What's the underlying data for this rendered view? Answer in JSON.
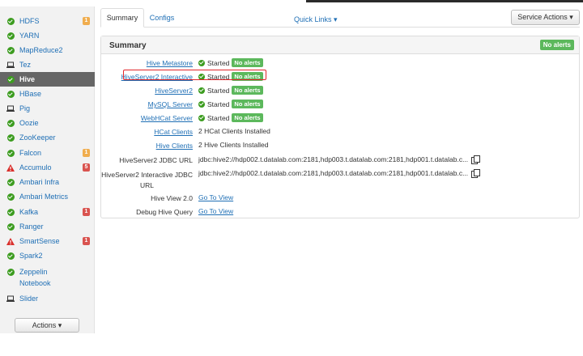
{
  "sidebar": {
    "services": [
      {
        "label": "HDFS",
        "status": "ok",
        "badge": "1",
        "badge_color": "orange"
      },
      {
        "label": "YARN",
        "status": "ok",
        "badge": ""
      },
      {
        "label": "MapReduce2",
        "status": "ok",
        "badge": ""
      },
      {
        "label": "Tez",
        "status": "client",
        "badge": ""
      },
      {
        "label": "Hive",
        "status": "ok",
        "badge": "",
        "active": true
      },
      {
        "label": "HBase",
        "status": "ok",
        "badge": ""
      },
      {
        "label": "Pig",
        "status": "client",
        "badge": ""
      },
      {
        "label": "Oozie",
        "status": "ok",
        "badge": ""
      },
      {
        "label": "ZooKeeper",
        "status": "ok",
        "badge": ""
      },
      {
        "label": "Falcon",
        "status": "ok",
        "badge": "1",
        "badge_color": "orange"
      },
      {
        "label": "Accumulo",
        "status": "warning",
        "badge": "5",
        "badge_color": "red"
      },
      {
        "label": "Ambari Infra",
        "status": "ok",
        "badge": ""
      },
      {
        "label": "Ambari Metrics",
        "status": "ok",
        "badge": ""
      },
      {
        "label": "Kafka",
        "status": "ok",
        "badge": "1",
        "badge_color": "red"
      },
      {
        "label": "Ranger",
        "status": "ok",
        "badge": ""
      },
      {
        "label": "SmartSense",
        "status": "warning",
        "badge": "1",
        "badge_color": "red"
      },
      {
        "label": "Spark2",
        "status": "ok",
        "badge": ""
      },
      {
        "label": "Zeppelin Notebook",
        "status": "ok",
        "badge": ""
      },
      {
        "label": "Slider",
        "status": "client",
        "badge": ""
      }
    ],
    "actions_label": "Actions ▾"
  },
  "tabs": {
    "summary": "Summary",
    "configs": "Configs",
    "quick_links": "Quick Links ▾",
    "service_actions": "Service Actions ▾"
  },
  "panel": {
    "title": "Summary",
    "header_badge": "No alerts",
    "rows": [
      {
        "key": "Hive Metastore",
        "key_link": true,
        "state": "Started",
        "alerts": "No alerts"
      },
      {
        "key": "HiveServer2 Interactive",
        "key_link": true,
        "state": "Started",
        "alerts": "No alerts"
      },
      {
        "key": "HiveServer2",
        "key_link": true,
        "state": "Started",
        "alerts": "No alerts"
      },
      {
        "key": "MySQL Server",
        "key_link": true,
        "state": "Started",
        "alerts": "No alerts"
      },
      {
        "key": "WebHCat Server",
        "key_link": true,
        "state": "Started",
        "alerts": "No alerts"
      },
      {
        "key": "HCat Clients",
        "key_link": true,
        "value": "2 HCat Clients Installed"
      },
      {
        "key": "Hive Clients",
        "key_link": true,
        "value": "2 Hive Clients Installed"
      },
      {
        "key": "HiveServer2 JDBC URL",
        "key_link": false,
        "value": "jdbc:hive2://hdp002.t.datalab.com:2181,hdp003.t.datalab.com:2181,hdp001.t.datalab.c..."
      },
      {
        "key_line1": "HiveServer2 Interactive JDBC",
        "key_line2": "URL",
        "key_link": false,
        "value": "jdbc:hive2://hdp002.t.datalab.com:2181,hdp003.t.datalab.com:2181,hdp001.t.datalab.c..."
      },
      {
        "key": "Hive View 2.0",
        "key_link": false,
        "link": "Go To View"
      },
      {
        "key": "Debug Hive Query",
        "key_link": false,
        "link": "Go To View"
      }
    ]
  }
}
